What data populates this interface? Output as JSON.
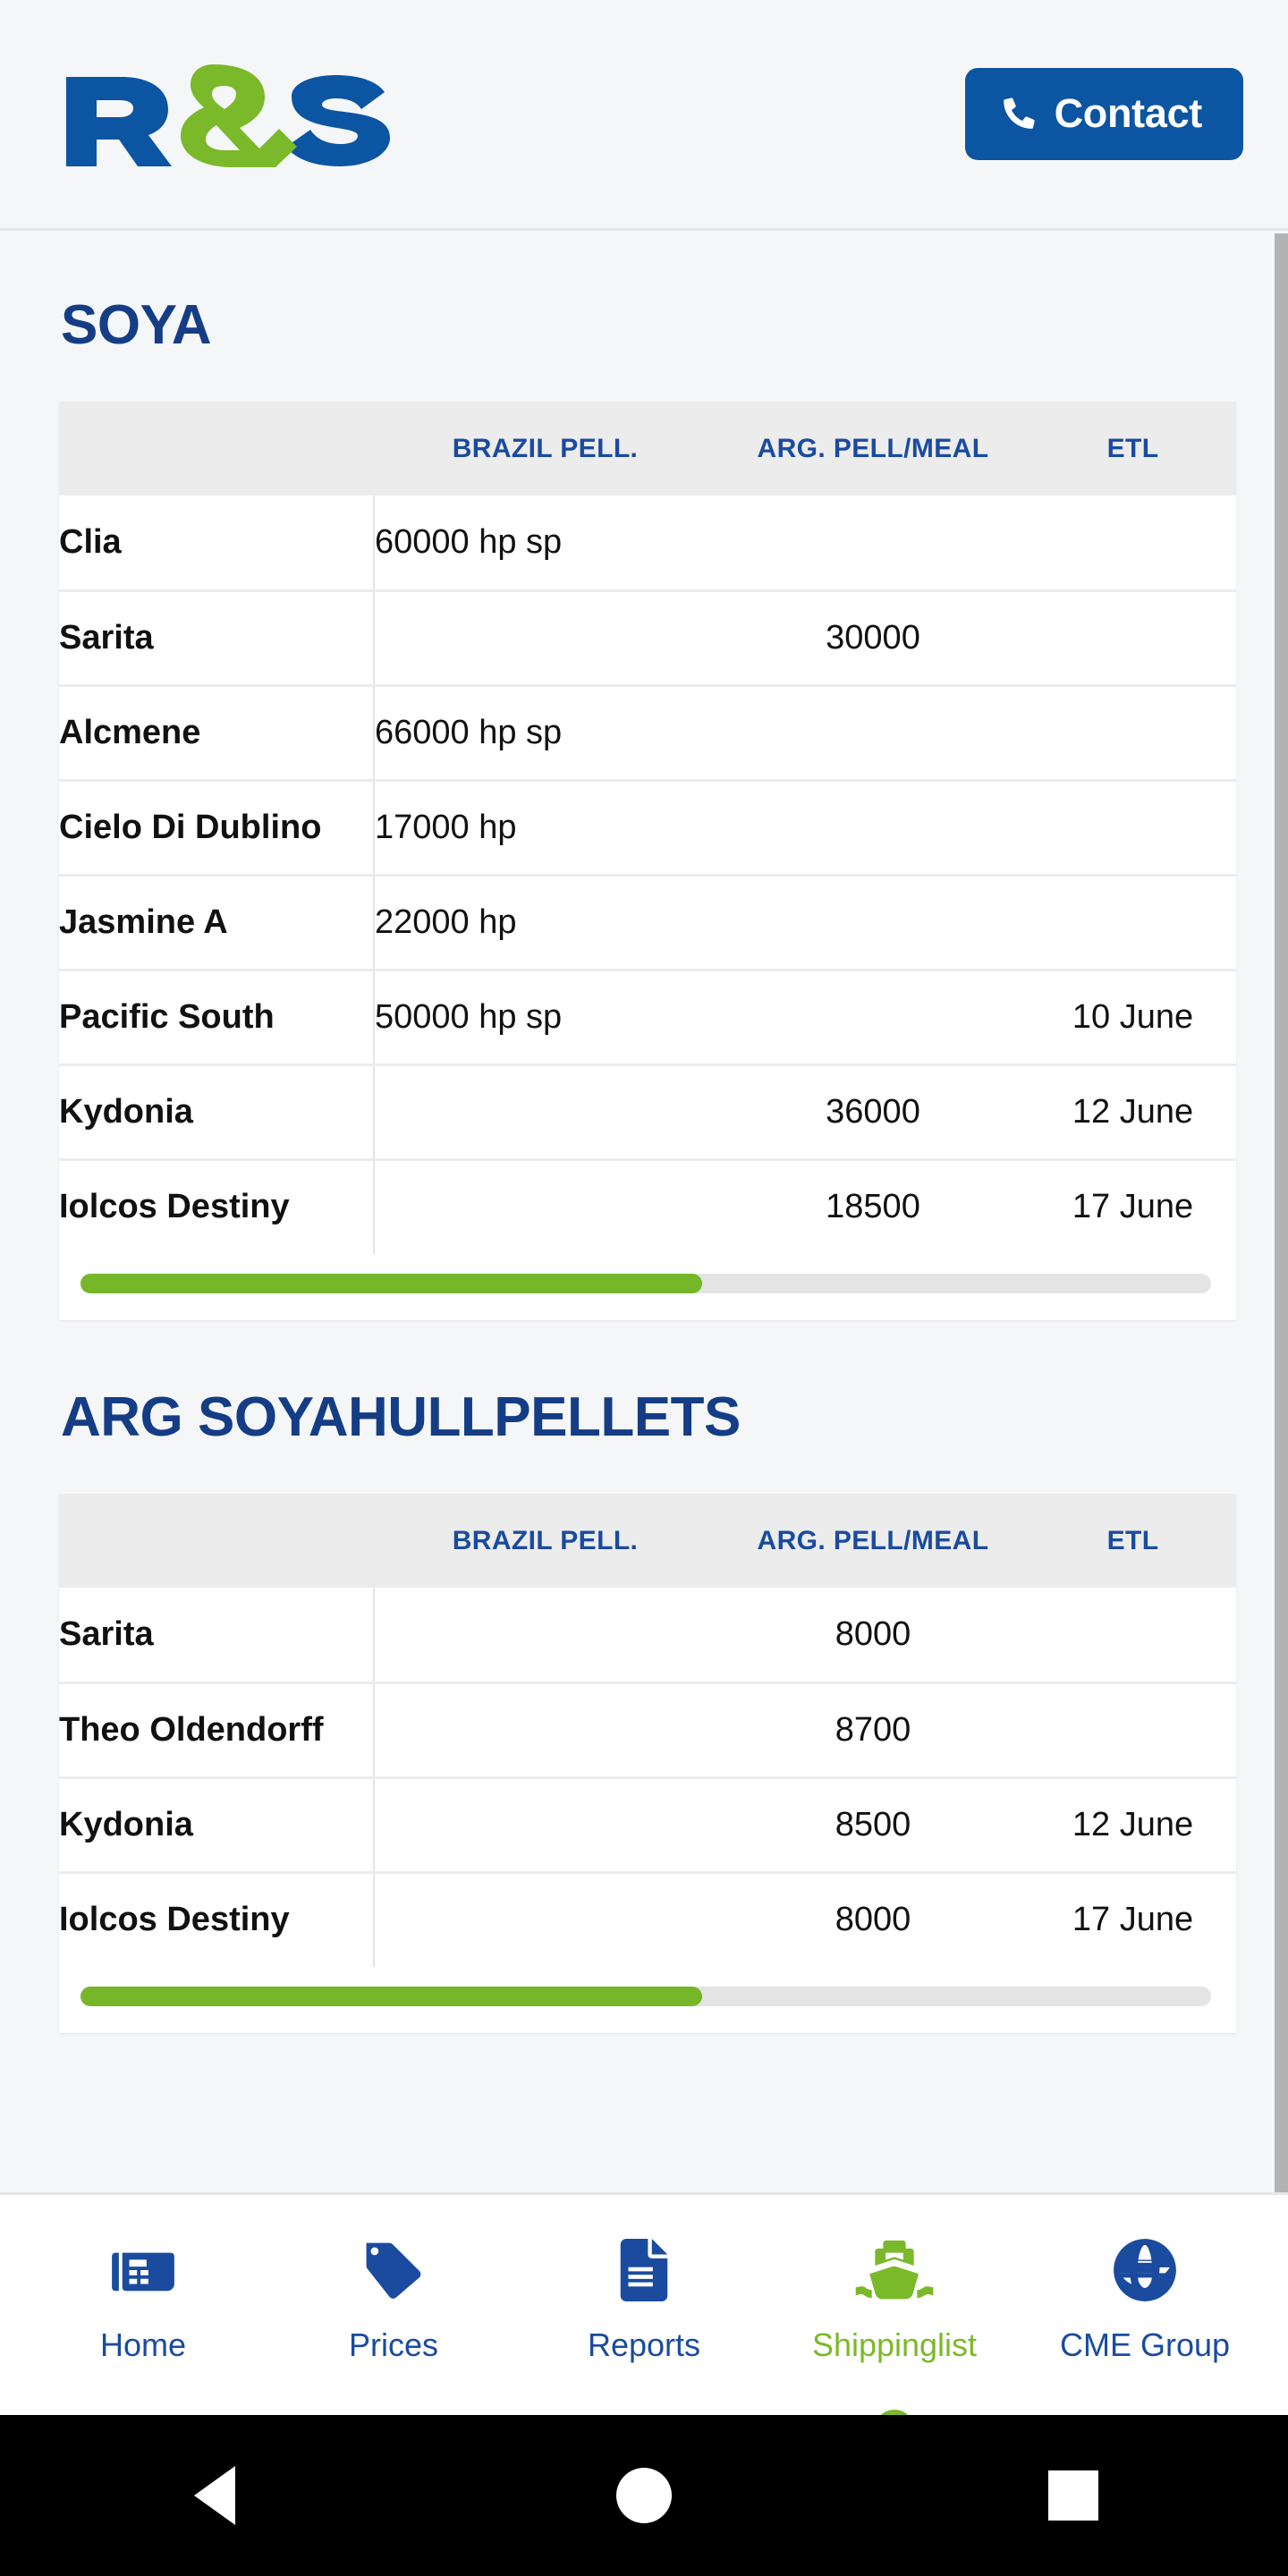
{
  "header": {
    "logo_text": "R&S",
    "logo_alt": "rs-logo",
    "contact_label": "Contact",
    "phone_icon": "phone-icon",
    "brand_blue": "#0b55a2",
    "brand_green": "#7ab929"
  },
  "sections": [
    {
      "title": "SOYA",
      "columns": [
        "",
        "BRAZIL PELL.",
        "ARG. PELL/MEAL",
        "ETL"
      ],
      "rows": [
        {
          "name": "Clia",
          "brazil": "60000 hp sp",
          "arg": "",
          "etl": ""
        },
        {
          "name": "Sarita",
          "brazil": "",
          "arg": "30000",
          "etl": ""
        },
        {
          "name": "Alcmene",
          "brazil": "66000 hp sp",
          "arg": "",
          "etl": ""
        },
        {
          "name": "Cielo Di Dublino",
          "brazil": "17000 hp",
          "arg": "",
          "etl": ""
        },
        {
          "name": "Jasmine A",
          "brazil": "22000 hp",
          "arg": "",
          "etl": ""
        },
        {
          "name": "Pacific South",
          "brazil": "50000 hp sp",
          "arg": "",
          "etl": "10 June"
        },
        {
          "name": "Kydonia",
          "brazil": "",
          "arg": "36000",
          "etl": "12 June"
        },
        {
          "name": "Iolcos Destiny",
          "brazil": "",
          "arg": "18500",
          "etl": "17 June"
        }
      ],
      "hscroll_percent": 55
    },
    {
      "title": "ARG SOYAHULLPELLETS",
      "columns": [
        "",
        "BRAZIL PELL.",
        "ARG. PELL/MEAL",
        "ETL"
      ],
      "rows": [
        {
          "name": "Sarita",
          "brazil": "",
          "arg": "8000",
          "etl": ""
        },
        {
          "name": "Theo Oldendorff",
          "brazil": "",
          "arg": "8700",
          "etl": ""
        },
        {
          "name": "Kydonia",
          "brazil": "",
          "arg": "8500",
          "etl": "12 June"
        },
        {
          "name": "Iolcos Destiny",
          "brazil": "",
          "arg": "8000",
          "etl": "17 June"
        }
      ],
      "hscroll_percent": 55
    }
  ],
  "bottom_nav": {
    "items": [
      {
        "label": "Home",
        "icon": "newspaper-icon",
        "active": false
      },
      {
        "label": "Prices",
        "icon": "price-tag-icon",
        "active": false
      },
      {
        "label": "Reports",
        "icon": "document-icon",
        "active": false
      },
      {
        "label": "Shippinglist",
        "icon": "ship-icon",
        "active": true
      },
      {
        "label": "CME Group",
        "icon": "globe-icon",
        "active": false
      }
    ]
  },
  "android_bar": {
    "back_label": "back-button",
    "home_label": "home-button",
    "recents_label": "recents-button"
  }
}
